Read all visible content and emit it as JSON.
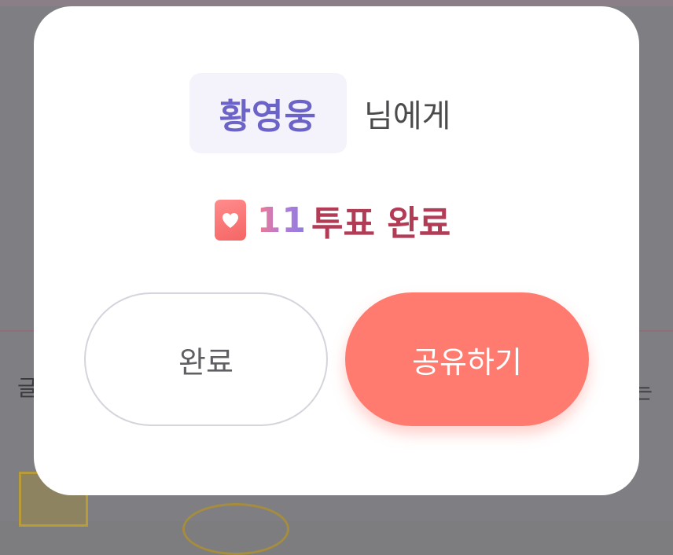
{
  "modal": {
    "recipient_name": "황영웅",
    "recipient_suffix": "님에게",
    "vote_count": "11",
    "vote_label": "투표 완료",
    "heart_icon": "heart-icon",
    "buttons": {
      "done_label": "완료",
      "share_label": "공유하기"
    }
  },
  "colors": {
    "name": "#6c63c8",
    "vote_label": "#b23b55",
    "share_button": "#ff7b70",
    "heart_badge": "#f56565"
  }
}
